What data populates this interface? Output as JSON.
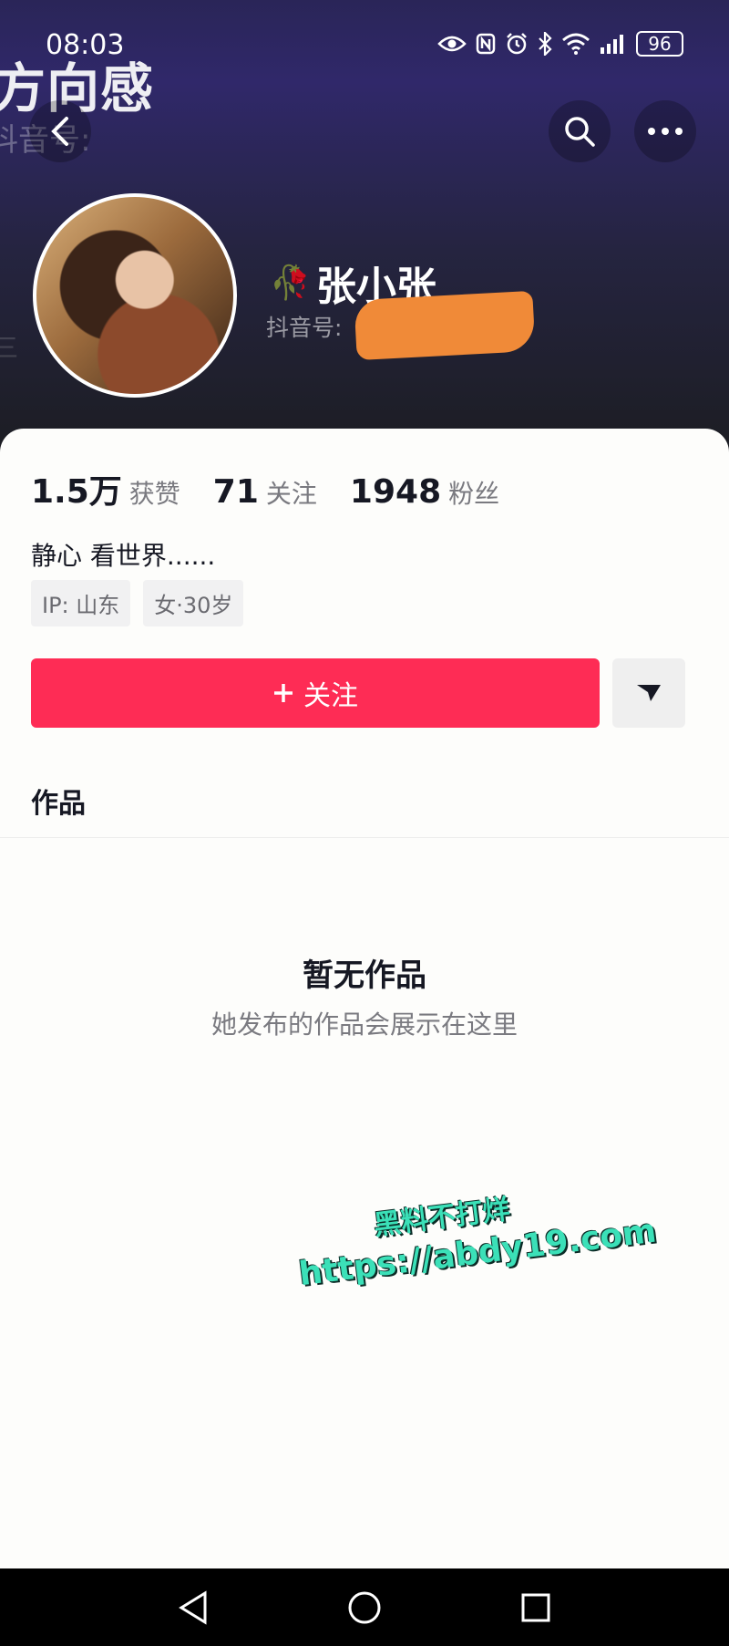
{
  "status_bar": {
    "time": "08:03",
    "battery": "96"
  },
  "background_header": {
    "title_fragment": "方向感",
    "id_fragment": "抖音号:",
    "side_fragment": "三"
  },
  "profile": {
    "name": "张小张",
    "name_emoji_icon": "wilted-flower-icon",
    "douyin_id_label": "抖音号:",
    "stats": [
      {
        "value": "1.5万",
        "label": "获赞"
      },
      {
        "value": "71",
        "label": "关注"
      },
      {
        "value": "1948",
        "label": "粉丝"
      }
    ],
    "bio": "静心 看世界......",
    "tags": [
      "IP:  山东",
      "女·30岁"
    ]
  },
  "actions": {
    "follow_label": "关注",
    "follow_icon": "plus-icon",
    "more_icon": "triangle-down-icon"
  },
  "tabs": {
    "works": "作品"
  },
  "empty_state": {
    "title": "暂无作品",
    "subtitle": "她发布的作品会展示在这里"
  },
  "watermark": {
    "line1": "黑料不打烊",
    "line2": "https://abdy19.com"
  },
  "colors": {
    "accent": "#fe2c55",
    "header_top": "#2a2558",
    "redaction": "#f08a38",
    "watermark": "#3be0b8"
  }
}
